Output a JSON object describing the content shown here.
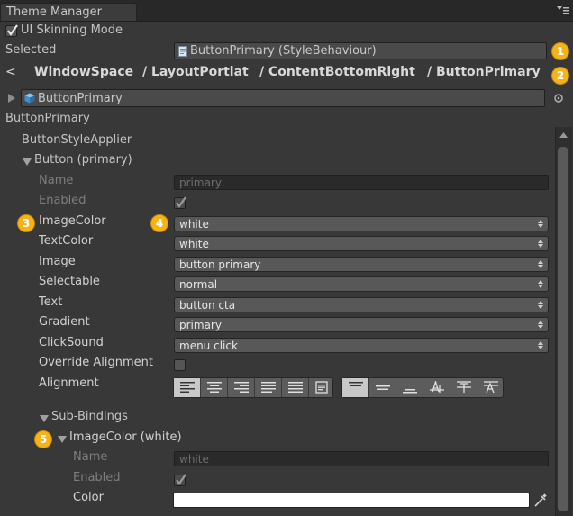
{
  "window": {
    "tab_title": "Theme Manager"
  },
  "header": {
    "skinning_label": "UI Skinning Mode",
    "skinning_checked": true,
    "selected_label": "Selected",
    "selected_value": "ButtonPrimary (StyleBehaviour)"
  },
  "breadcrumb": {
    "back": "<",
    "items": [
      "WindowSpace",
      "/ LayoutPortiat",
      "/ ContentBottomRight",
      "/ ButtonPrimary"
    ]
  },
  "object_field": {
    "value": "ButtonPrimary"
  },
  "component": {
    "title": "ButtonPrimary",
    "applier": "ButtonStyleApplier",
    "section": "Button (primary)",
    "name_label": "Name",
    "name_value": "primary",
    "enabled_label": "Enabled",
    "properties": [
      {
        "label": "ImageColor",
        "value": "white"
      },
      {
        "label": "TextColor",
        "value": "white"
      },
      {
        "label": "Image",
        "value": "button primary"
      },
      {
        "label": "Selectable",
        "value": "normal"
      },
      {
        "label": "Text",
        "value": "button cta"
      },
      {
        "label": "Gradient",
        "value": "primary"
      },
      {
        "label": "ClickSound",
        "value": "menu click"
      }
    ],
    "override_alignment_label": "Override Alignment",
    "alignment_label": "Alignment",
    "sub_bindings_label": "Sub-Bindings",
    "sub_binding": {
      "title": "ImageColor (white)",
      "name_label": "Name",
      "name_value": "white",
      "enabled_label": "Enabled",
      "color_label": "Color",
      "color_value": "#ffffff"
    }
  },
  "badges": [
    "1",
    "2",
    "3",
    "4",
    "5"
  ],
  "icons": {
    "tab_menu": "menu-icon",
    "script": "script-icon",
    "cube": "cube-icon",
    "picker": "object-picker-icon",
    "eyedropper": "eyedropper-icon"
  }
}
